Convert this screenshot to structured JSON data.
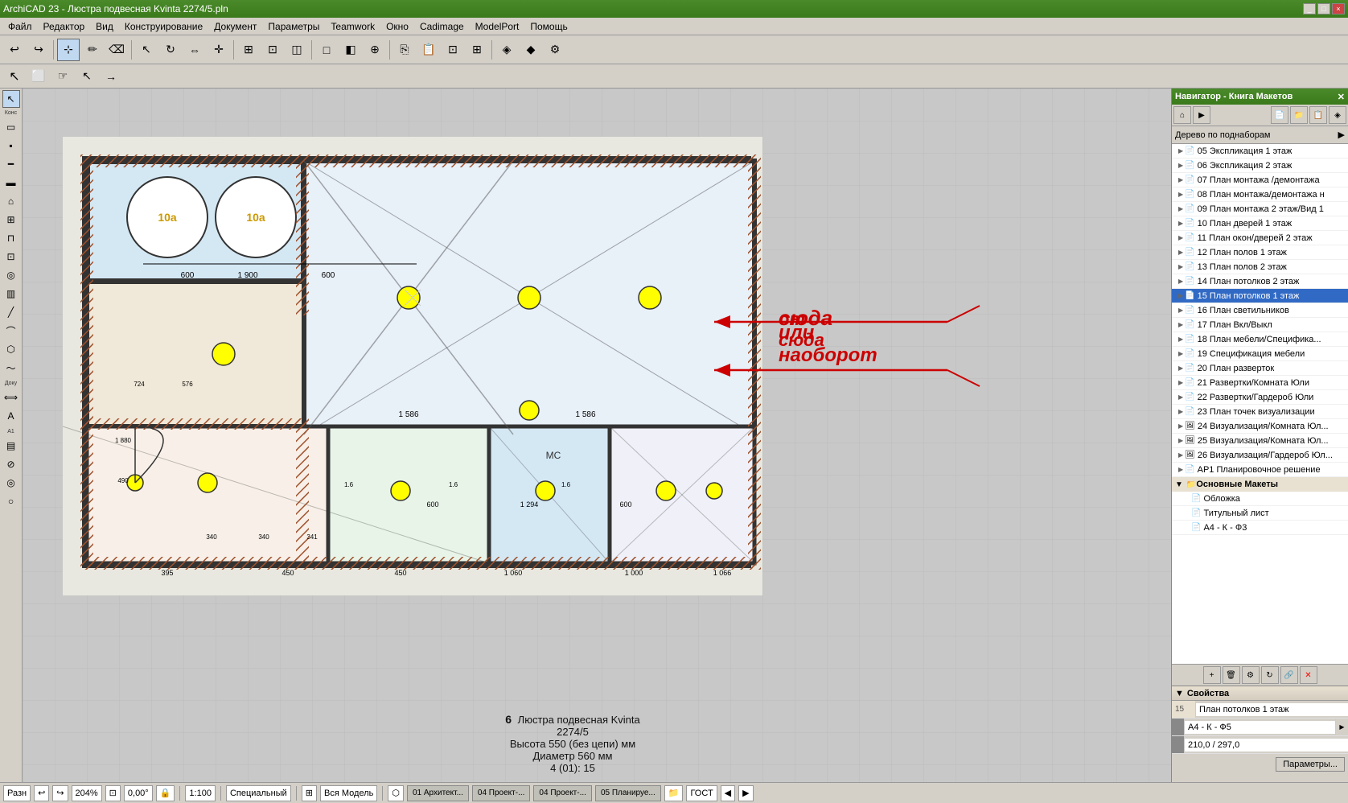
{
  "title_bar": {
    "title": "ArchiCAD 23 - Люстра подвесная Kvinta 2274/5.pln",
    "controls": [
      "_",
      "□",
      "×"
    ]
  },
  "menu": {
    "items": [
      "Файл",
      "Редактор",
      "Вид",
      "Конструирование",
      "Документ",
      "Параметры",
      "Teamwork",
      "Окно",
      "Cadimage",
      "ModelPort",
      "Помощь"
    ]
  },
  "navigator": {
    "title": "Навигатор - Книга Макетов",
    "tree_label": "Дерево по поднаборам",
    "items": [
      {
        "id": "05",
        "label": "05 Экспликация 1 этаж",
        "expanded": false
      },
      {
        "id": "06",
        "label": "06 Экспликация 2 этаж",
        "expanded": false
      },
      {
        "id": "07",
        "label": "07 План монтажа /демонтажа",
        "expanded": false
      },
      {
        "id": "08",
        "label": "08 План монтажа/демонтажа н",
        "expanded": false
      },
      {
        "id": "09",
        "label": "09 План монтажа 2 этаж/Вид 1",
        "expanded": false
      },
      {
        "id": "10",
        "label": "10 План дверей 1 этаж",
        "expanded": false
      },
      {
        "id": "11",
        "label": "11 План окон/дверей 2 этаж",
        "expanded": false
      },
      {
        "id": "12",
        "label": "12 План полов 1 этаж",
        "expanded": false
      },
      {
        "id": "13",
        "label": "13 План полов 2 этаж",
        "expanded": false
      },
      {
        "id": "14",
        "label": "14 План потолков 2 этаж",
        "expanded": false,
        "highlighted": true
      },
      {
        "id": "15",
        "label": "15 План потолков 1 этаж",
        "expanded": false,
        "selected": true
      },
      {
        "id": "16",
        "label": "16 План светильников",
        "expanded": false
      },
      {
        "id": "17",
        "label": "17 План Вкл/Выкл",
        "expanded": false
      },
      {
        "id": "18",
        "label": "18 План мебели/Специфика...",
        "expanded": false
      },
      {
        "id": "19",
        "label": "19 Спецификация мебели",
        "expanded": false
      },
      {
        "id": "20",
        "label": "20 План разверток",
        "expanded": false
      },
      {
        "id": "21",
        "label": "21 Развертки/Комната Юли",
        "expanded": false
      },
      {
        "id": "22",
        "label": "22 Развертки/Гардероб Юли",
        "expanded": false
      },
      {
        "id": "23",
        "label": "23 План точек визуализации",
        "expanded": false
      },
      {
        "id": "24",
        "label": "24 Визуализация/Комната Юл...",
        "expanded": false,
        "has_icon": true
      },
      {
        "id": "25",
        "label": "25 Визуализация/Комната Юл...",
        "expanded": false,
        "has_icon": true
      },
      {
        "id": "26",
        "label": "26 Визуализация/Гардероб Юл...",
        "expanded": false,
        "has_icon": true
      },
      {
        "id": "AP1",
        "label": "АР1 Планировочное решение",
        "expanded": false
      },
      {
        "id": "main_group",
        "label": "Основные Макеты",
        "is_section": true
      },
      {
        "id": "cover",
        "label": "Обложка",
        "is_section_item": true
      },
      {
        "id": "title",
        "label": "Титульный лист",
        "is_section_item": true
      },
      {
        "id": "a4kf3",
        "label": "А4 - К - Ф3",
        "is_section_item": true
      }
    ]
  },
  "properties": {
    "title": "Свойства",
    "rows": [
      {
        "label": "15",
        "value": "План потолков 1 этаж"
      },
      {
        "label": "А4",
        "value": "А4 - К - Ф5"
      },
      {
        "label": "210,0 / 297,0",
        "value": ""
      }
    ],
    "params_btn": "Параметры..."
  },
  "annotation": {
    "line1": "сюда",
    "line2": "от сюда",
    "line3": "или наоборот"
  },
  "info_box": {
    "number": "6",
    "line1": "Люстра подвесная Kvinta",
    "line2": "2274/5",
    "line3": "Высота 550 (без цепи) мм",
    "line4": "Диаметр 560 мм",
    "line5": "4 (01): 15"
  },
  "status_bar": {
    "mode": "Разн",
    "zoom": "204%",
    "angle": "0,00°",
    "scale": "1:100",
    "special": "Специальный",
    "model": "Вся Модель",
    "arch": "01 Архитект...",
    "tab1": "04 Проект-...",
    "tab2": "04 Проект-...",
    "tab3": "05 Планируе...",
    "standard": "ГОСТ"
  }
}
